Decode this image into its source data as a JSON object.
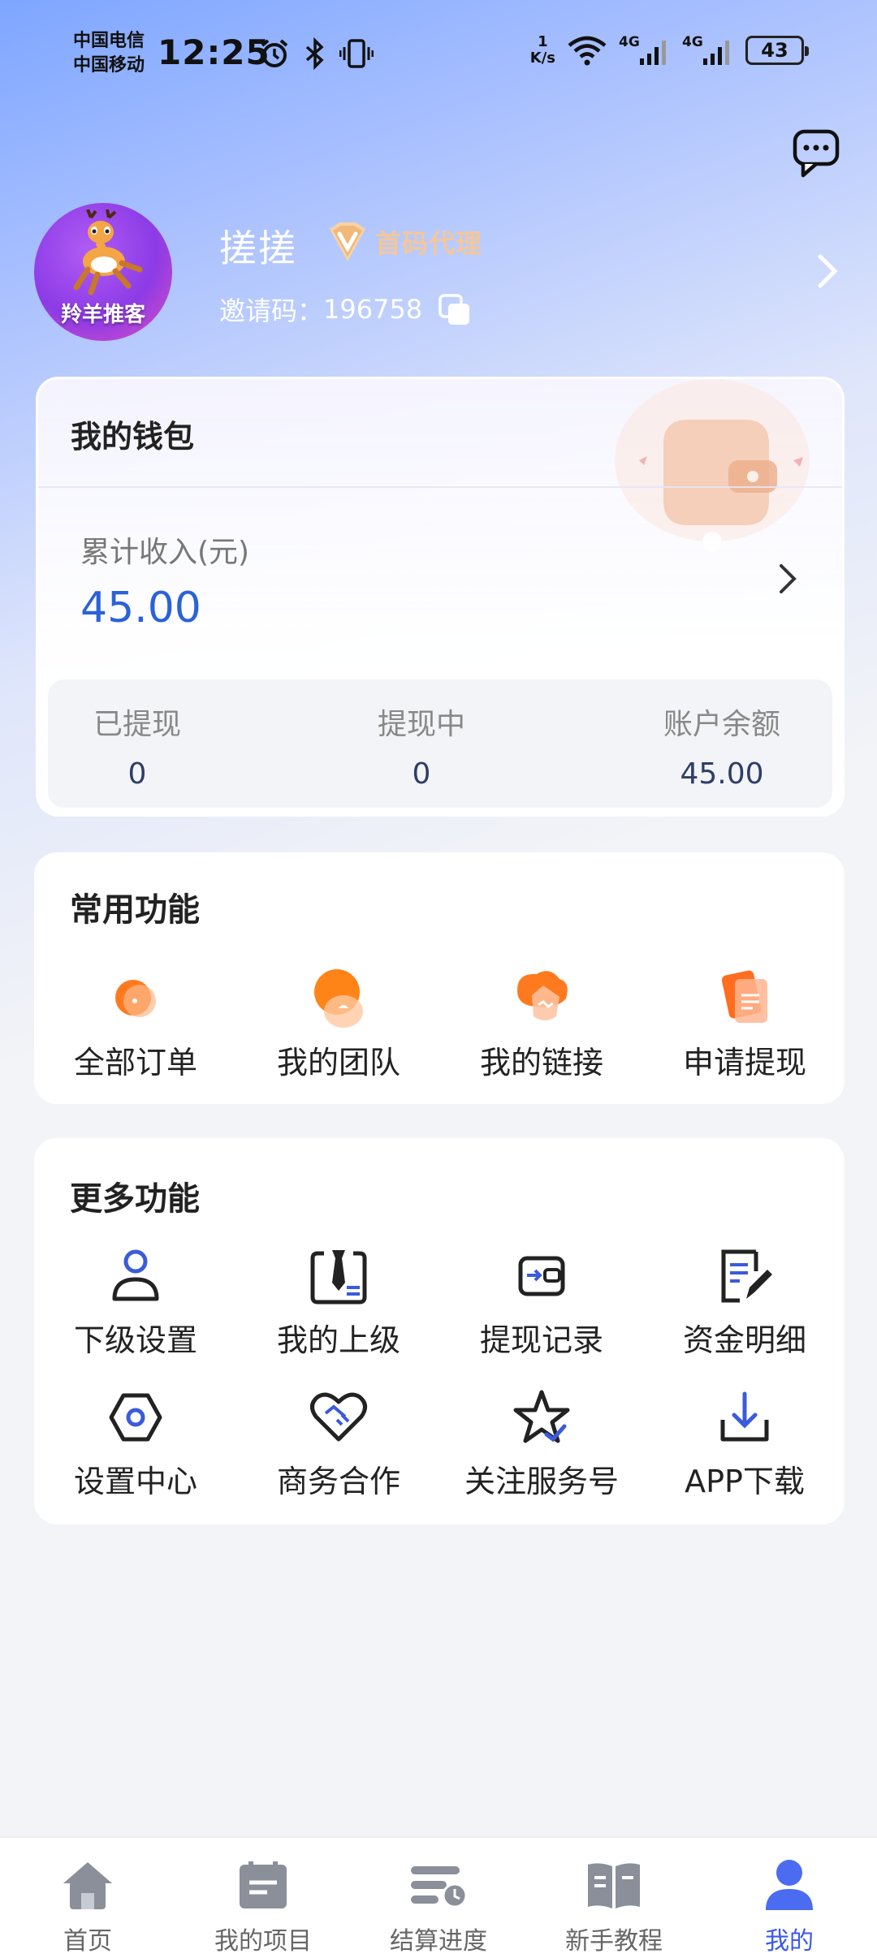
{
  "status_bar": {
    "carrier_1": "中国电信",
    "carrier_2": "中国移动",
    "time": "12:25",
    "net_speed_value": "1",
    "net_speed_unit": "K/s",
    "signal_1": "4G",
    "signal_2": "4G",
    "battery": "43"
  },
  "profile": {
    "avatar_text": "羚羊推客",
    "name": "搓搓",
    "badge": "首码代理",
    "invite_label": "邀请码：",
    "invite_code": "196758"
  },
  "wallet": {
    "title": "我的钱包",
    "income_label": "累计收入(元)",
    "income_value": "45.00",
    "stats": [
      {
        "label": "已提现",
        "value": "0"
      },
      {
        "label": "提现中",
        "value": "0"
      },
      {
        "label": "账户余额",
        "value": "45.00"
      }
    ]
  },
  "common_functions": {
    "title": "常用功能",
    "items": [
      {
        "label": "全部订单",
        "icon": "orders-icon"
      },
      {
        "label": "我的团队",
        "icon": "team-icon"
      },
      {
        "label": "我的链接",
        "icon": "link-icon"
      },
      {
        "label": "申请提现",
        "icon": "withdraw-icon"
      }
    ]
  },
  "more_functions": {
    "title": "更多功能",
    "items": [
      {
        "label": "下级设置",
        "icon": "person-icon"
      },
      {
        "label": "我的上级",
        "icon": "tie-icon"
      },
      {
        "label": "提现记录",
        "icon": "wallet-icon"
      },
      {
        "label": "资金明细",
        "icon": "document-edit-icon"
      },
      {
        "label": "设置中心",
        "icon": "hexagon-settings-icon"
      },
      {
        "label": "商务合作",
        "icon": "handshake-heart-icon"
      },
      {
        "label": "关注服务号",
        "icon": "star-check-icon"
      },
      {
        "label": "APP下载",
        "icon": "download-icon"
      }
    ]
  },
  "bottom_nav": {
    "items": [
      {
        "label": "首页",
        "icon": "home-icon",
        "active": false
      },
      {
        "label": "我的项目",
        "icon": "project-icon",
        "active": false
      },
      {
        "label": "结算进度",
        "icon": "settlement-icon",
        "active": false
      },
      {
        "label": "新手教程",
        "icon": "book-icon",
        "active": false
      },
      {
        "label": "我的",
        "icon": "user-icon",
        "active": true
      }
    ]
  },
  "colors": {
    "accent_blue": "#2a62d8",
    "nav_active": "#3a5ae8",
    "orange": "#ff7a1f",
    "badge_gold": "#f3c79a"
  }
}
